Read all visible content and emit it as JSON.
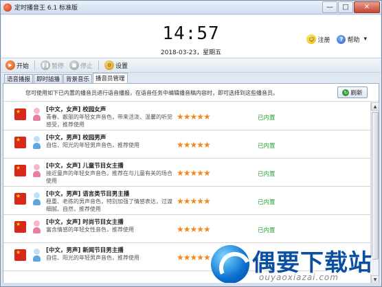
{
  "window": {
    "title": "定时播音王 6.1 标准版",
    "buttons": {
      "minimize": "—",
      "maximize": "□",
      "close": "✕"
    }
  },
  "header": {
    "time": "14:57",
    "date": "2018-03-23，星期五",
    "register_label": "注册",
    "help_label": "帮助",
    "help_dropdown": "▾"
  },
  "toolbar": {
    "start": "开始",
    "pause": "暂停",
    "stop": "停止",
    "settings": "设置"
  },
  "tabs": [
    "语音播报",
    "即时插播",
    "背景音乐",
    "播音员管理"
  ],
  "active_tab": 3,
  "panel": {
    "notice": "您可使用如下已内置的播音员进行语音播报，在语音任务中编辑播音稿内容时，即可选择到这些播音员。",
    "refresh_label": "刷新"
  },
  "announcers": [
    {
      "title": "[中文，女声] 校园女声",
      "desc": "青春、靓丽的年轻女声音色，带来活泼、温馨的听觉感受，推荐使用",
      "gender": "female",
      "rating": 5,
      "status": "已内置"
    },
    {
      "title": "[中文，男声] 校园男声",
      "desc": "自信、阳光的年轻男声音色，推荐使用",
      "gender": "male",
      "rating": 5,
      "status": "已内置"
    },
    {
      "title": "[中文，女声] 儿童节目女主播",
      "desc": "接近童声的年轻女声音色，推荐在与儿童有关的场合使用",
      "gender": "female",
      "rating": 5,
      "status": "已内置"
    },
    {
      "title": "[中文，男声] 语言类节目男主播",
      "desc": "稳重、老练的男声音色，特别加强了情感表达，过渡细腻、自然，推荐使用",
      "gender": "male",
      "rating": 5,
      "status": "已内置"
    },
    {
      "title": "[中文，女声] 时尚节目女主播",
      "desc": "富含情感的年轻女性音色，推荐使用",
      "gender": "female",
      "rating": 5,
      "status": "已内置"
    },
    {
      "title": "[中文，男声] 新闻节目男主播",
      "desc": "自信、阳光的年轻男声音色，推荐使用",
      "gender": "male",
      "rating": 5,
      "status": "已内置"
    }
  ],
  "watermark": {
    "text": "偶要下载站",
    "url": "ouyaoxiazai.com"
  },
  "icons": {
    "app": "clock-app-icon",
    "register": "smiley-icon",
    "help": "question-icon",
    "start": "play-icon",
    "pause": "pause-icon",
    "stop": "stop-icon",
    "settings": "gear-icon",
    "refresh": "refresh-icon",
    "flag": "china-flag-icon",
    "voice": "person-icon"
  },
  "colors": {
    "stars": "#f08a1c",
    "status": "#29a23a",
    "accent": "#0b4fa0"
  }
}
